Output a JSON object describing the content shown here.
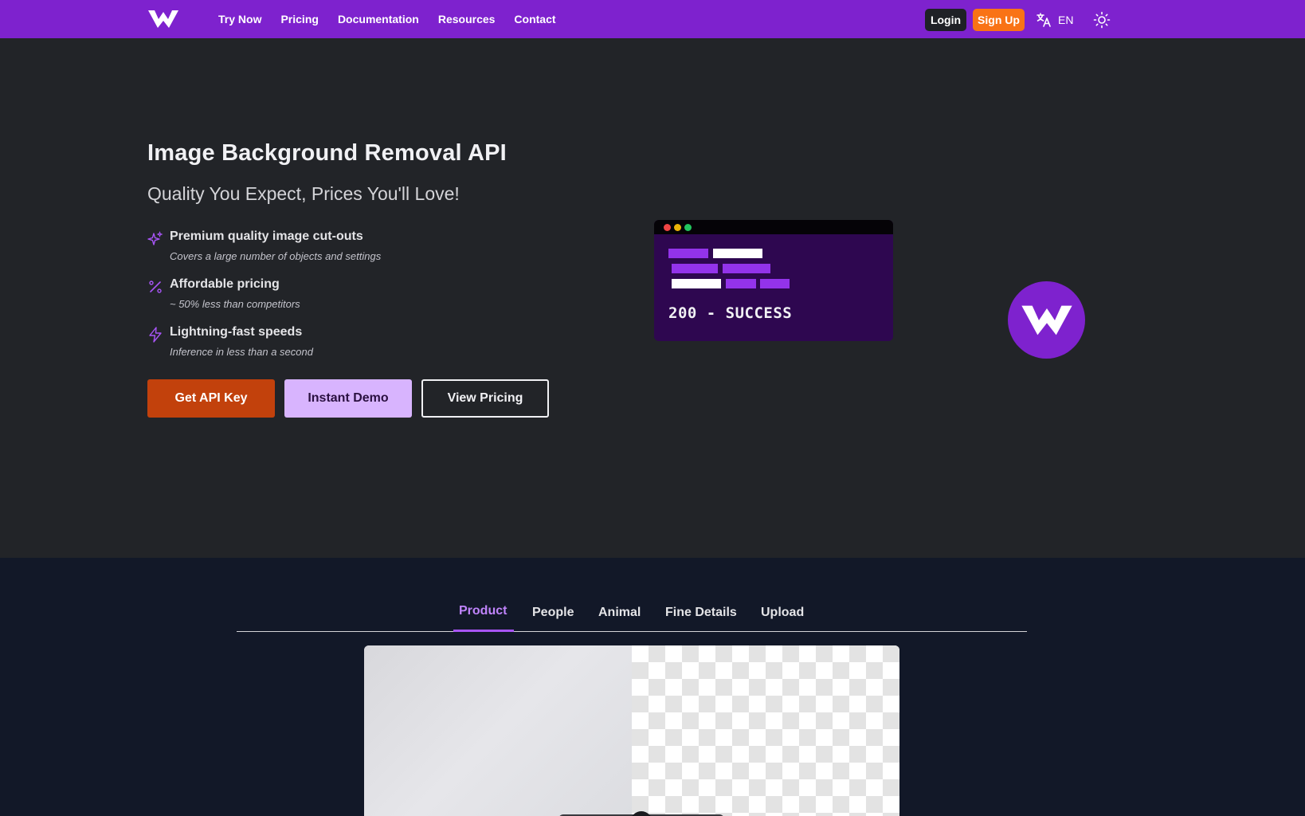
{
  "nav": {
    "links": [
      "Try Now",
      "Pricing",
      "Documentation",
      "Resources",
      "Contact"
    ],
    "login": "Login",
    "signup": "Sign Up",
    "language": "EN",
    "colors": {
      "bar": "#7e22ce",
      "signup": "#f97316"
    },
    "icons": [
      "logo-icon",
      "translate-icon",
      "sun-icon"
    ]
  },
  "hero": {
    "title": "Image Background Removal API",
    "subtitle": "Quality You Expect, Prices You'll Love!",
    "features": [
      {
        "title": "Premium quality image cut-outs",
        "desc": "Covers a large number of objects and settings",
        "icon": "sparkle-icon"
      },
      {
        "title": "Affordable pricing",
        "desc": "~ 50% less than competitors",
        "icon": "percent-icon"
      },
      {
        "title": "Lightning-fast speeds",
        "desc": "Inference in less than a second",
        "icon": "lightning-icon"
      }
    ],
    "buttons": {
      "primary": "Get API Key",
      "secondary": "Instant Demo",
      "outline": "View Pricing"
    },
    "terminal": {
      "status": "200 - SUCCESS"
    }
  },
  "demo": {
    "tabs": [
      "Product",
      "People",
      "Animal",
      "Fine Details",
      "Upload"
    ],
    "active_tab": "Product"
  }
}
